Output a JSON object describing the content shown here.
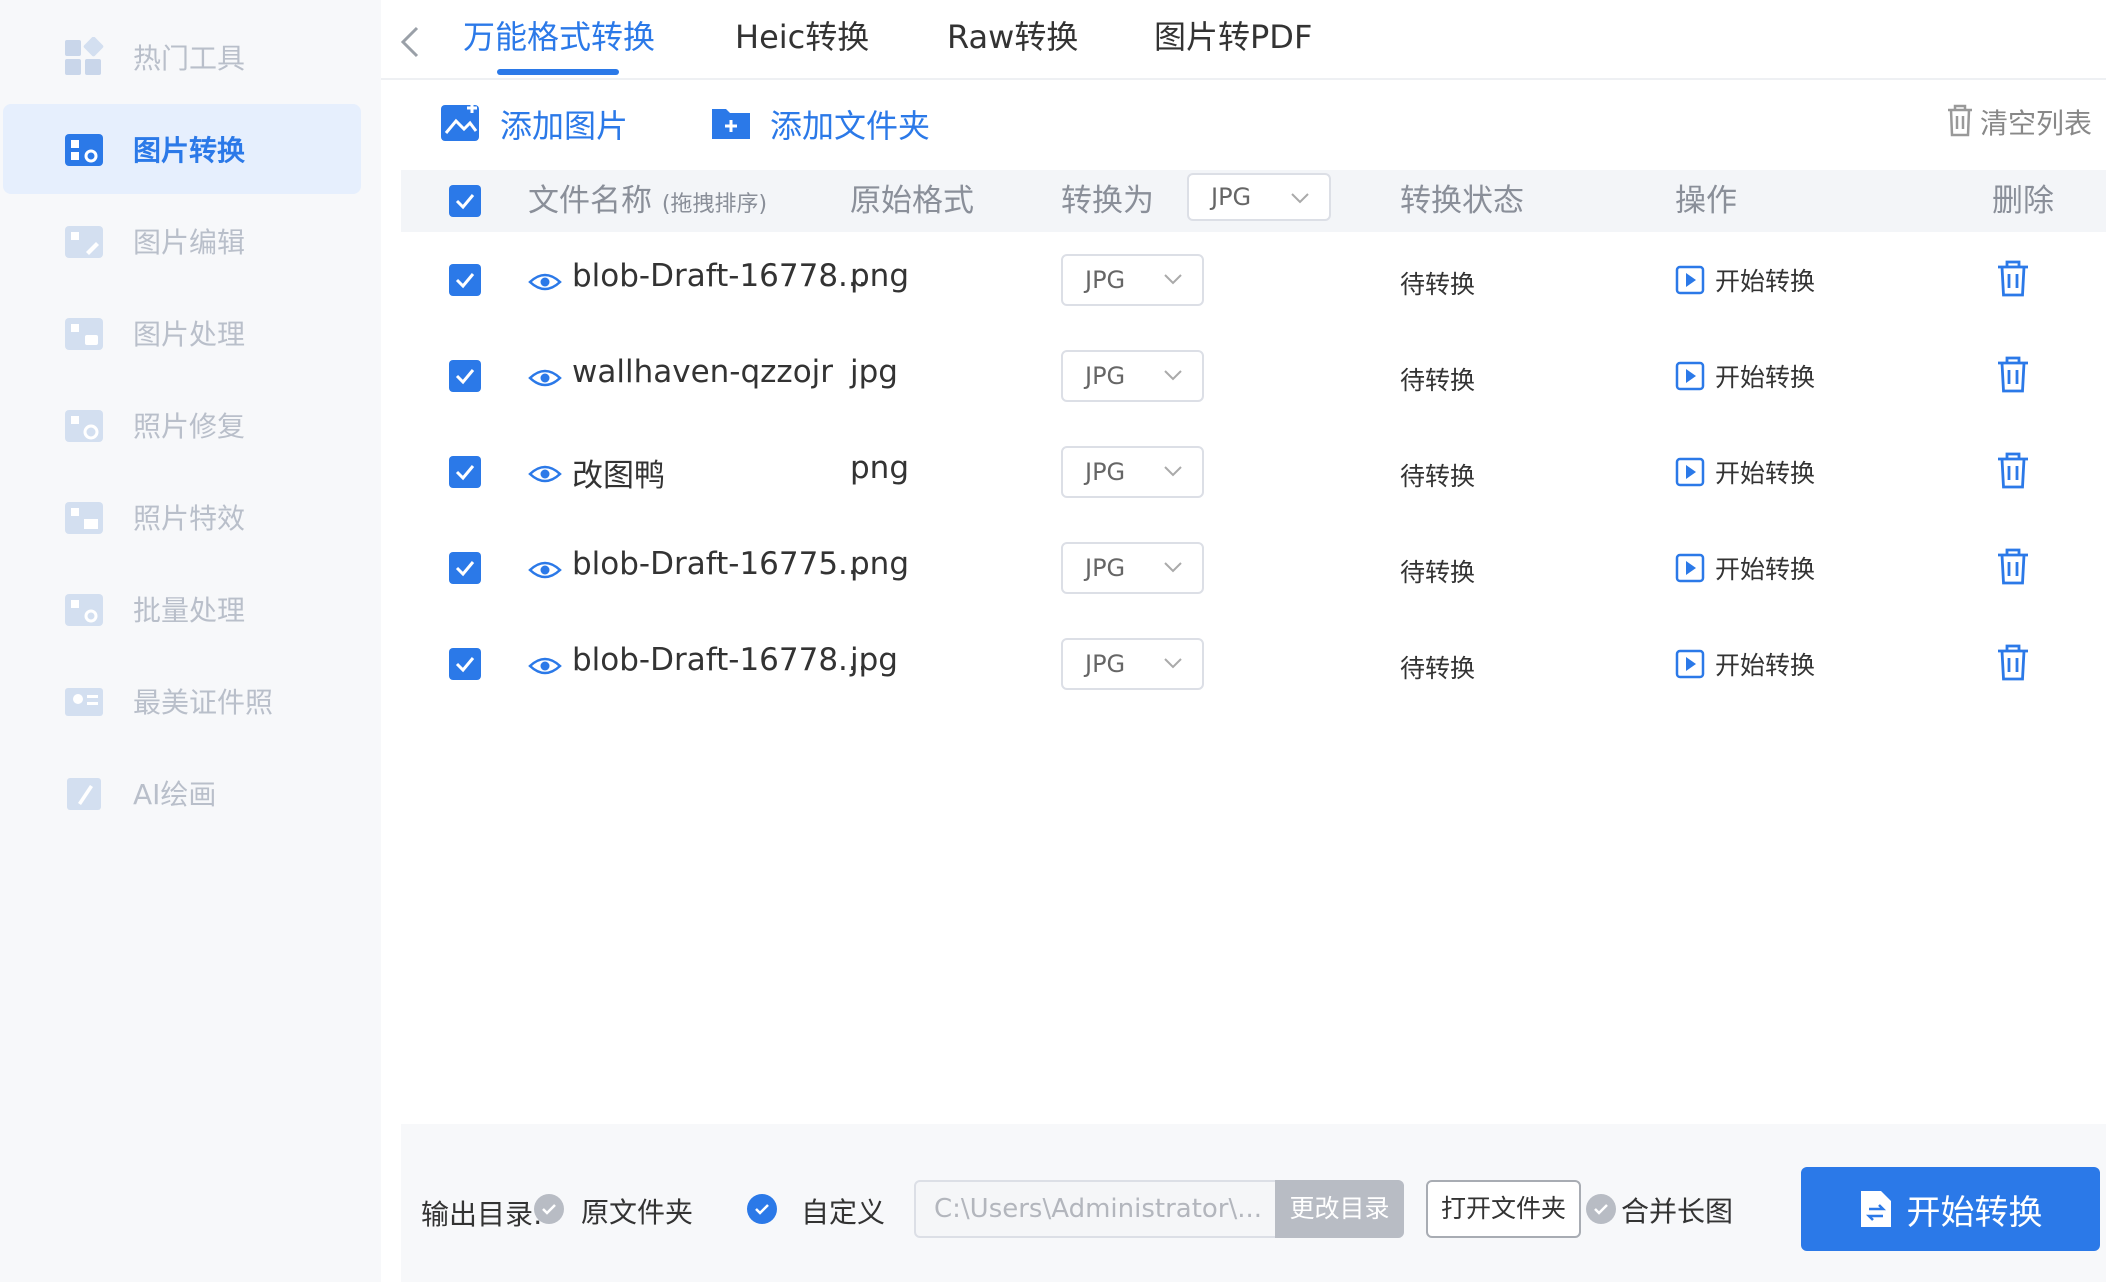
{
  "sidebar": {
    "items": [
      {
        "label": "热门工具",
        "icon": "grid-icon",
        "active": false
      },
      {
        "label": "图片转换",
        "icon": "image-convert-icon",
        "active": true
      },
      {
        "label": "图片编辑",
        "icon": "image-edit-icon",
        "active": false
      },
      {
        "label": "图片处理",
        "icon": "image-process-icon",
        "active": false
      },
      {
        "label": "照片修复",
        "icon": "photo-repair-icon",
        "active": false
      },
      {
        "label": "照片特效",
        "icon": "photo-effect-icon",
        "active": false
      },
      {
        "label": "批量处理",
        "icon": "batch-icon",
        "active": false
      },
      {
        "label": "最美证件照",
        "icon": "id-photo-icon",
        "active": false
      },
      {
        "label": "AI绘画",
        "icon": "ai-paint-icon",
        "active": false
      }
    ]
  },
  "tabs": [
    {
      "label": "万能格式转换",
      "active": true
    },
    {
      "label": "Heic转换",
      "active": false
    },
    {
      "label": "Raw转换",
      "active": false
    },
    {
      "label": "图片转PDF",
      "active": false
    }
  ],
  "toolbar": {
    "add_image": "添加图片",
    "add_folder": "添加文件夹",
    "clear_list": "清空列表"
  },
  "table": {
    "headers": {
      "filename": "文件名称",
      "filename_hint": "(拖拽排序)",
      "orig_format": "原始格式",
      "convert_to": "转换为",
      "convert_to_value": "JPG",
      "status": "转换状态",
      "operation": "操作",
      "delete": "删除"
    },
    "rows": [
      {
        "name": "blob-Draft-16778...",
        "format": "png",
        "target": "JPG",
        "status": "待转换",
        "action": "开始转换"
      },
      {
        "name": "wallhaven-qzzojr",
        "format": "jpg",
        "target": "JPG",
        "status": "待转换",
        "action": "开始转换"
      },
      {
        "name": "改图鸭",
        "format": "png",
        "target": "JPG",
        "status": "待转换",
        "action": "开始转换"
      },
      {
        "name": "blob-Draft-16775...",
        "format": "png",
        "target": "JPG",
        "status": "待转换",
        "action": "开始转换"
      },
      {
        "name": "blob-Draft-16778...",
        "format": "jpg",
        "target": "JPG",
        "status": "待转换",
        "action": "开始转换"
      }
    ]
  },
  "footer": {
    "output_label": "输出目录:",
    "option_original": "原文件夹",
    "option_custom": "自定义",
    "path_value": "C:\\Users\\Administrator\\...",
    "change_dir": "更改目录",
    "open_folder": "打开文件夹",
    "merge_long": "合并长图",
    "start": "开始转换"
  },
  "colors": {
    "accent": "#2b79e8",
    "sidebar_bg": "#f7f8fa",
    "active_bg": "#e6effd",
    "muted": "#b9bfca"
  }
}
